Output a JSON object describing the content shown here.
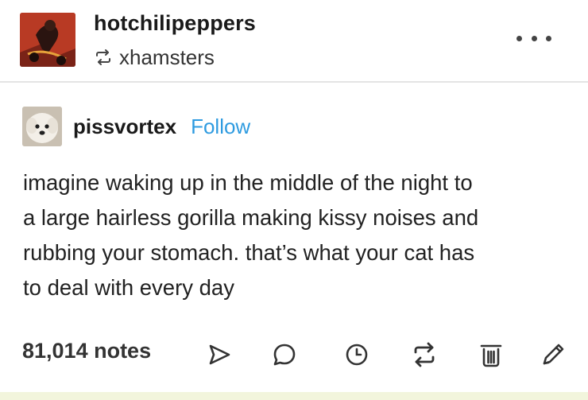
{
  "post": {
    "blog_name": "hotchilipeppers",
    "reblogged_from": "xhamsters",
    "original_poster": "pissvortex",
    "follow_label": "Follow",
    "body_lines": [
      "imagine waking up in the middle of the night to",
      "a large hairless gorilla making kissy noises and",
      "rubbing your stomach. that’s what your cat has",
      "to deal with every day"
    ],
    "notes_label": "81,014 notes"
  },
  "icons": {
    "reblog_small": "reblog-icon",
    "more": "more-options-icon",
    "share": "share-icon",
    "reply": "reply-icon",
    "queue": "clock-icon",
    "reblog": "reblog-icon",
    "delete": "trash-icon",
    "edit": "pencil-icon"
  },
  "colors": {
    "accent_link": "#2e9be0",
    "text": "#1a1a1a"
  }
}
